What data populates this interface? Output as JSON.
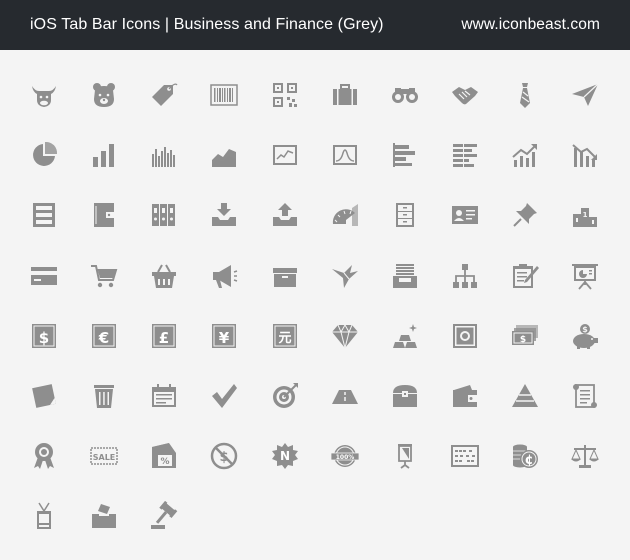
{
  "header": {
    "title": "iOS Tab Bar Icons | Business and Finance (Grey)",
    "site": "www.iconbeast.com"
  },
  "colors": {
    "header_bg": "#262a2f",
    "header_text": "#ffffff",
    "page_bg": "#f4f4f4",
    "icon_fill": "#8e8e8e"
  },
  "rows": [
    [
      "bull-icon",
      "bear-icon",
      "price-tag-icon",
      "barcode-icon",
      "qr-code-icon",
      "briefcase-icon",
      "binoculars-icon",
      "handshake-icon",
      "necktie-icon",
      "paper-plane-icon"
    ],
    [
      "pie-chart-icon",
      "bar-chart-icon",
      "bar-graph-thin-icon",
      "area-chart-icon",
      "line-chart-screen-icon",
      "bell-curve-screen-icon",
      "horizontal-bar-chart-icon",
      "stacked-bar-chart-icon",
      "trend-up-icon",
      "trend-down-icon"
    ],
    [
      "server-cabinet-icon",
      "wallet-notebook-icon",
      "binders-icon",
      "inbox-download-icon",
      "outbox-upload-icon",
      "protractor-icon",
      "filing-cabinet-icon",
      "id-card-icon",
      "push-pin-icon",
      "podium-icon"
    ],
    [
      "credit-card-icon",
      "shopping-cart-icon",
      "shopping-basket-icon",
      "megaphone-icon",
      "archive-box-icon",
      "origami-bird-icon",
      "paper-tray-icon",
      "org-chart-icon",
      "clipboard-pencil-icon",
      "presentation-board-icon"
    ],
    [
      "dollar-box-icon",
      "euro-box-icon",
      "pound-box-icon",
      "yen-box-icon",
      "yuan-box-icon",
      "diamond-icon",
      "gold-bars-icon",
      "safe-icon",
      "money-stack-icon",
      "piggy-bank-icon"
    ],
    [
      "sticky-note-icon",
      "trash-bin-icon",
      "calendar-ticket-icon",
      "checkmark-icon",
      "target-dart-icon",
      "road-icon",
      "treasure-chest-icon",
      "wallet-icon",
      "pyramid-icon",
      "scroll-document-icon"
    ],
    [
      "award-ribbon-icon",
      "sale-tag-icon",
      "discount-flag-icon",
      "no-money-icon",
      "n-badge-icon",
      "hundred-percent-badge-icon",
      "banner-stand-icon",
      "abacus-icon",
      "coins-icon",
      "balance-scale-icon"
    ],
    [
      "id-badge-icon",
      "ballot-box-icon",
      "gavel-icon"
    ]
  ],
  "icon_text": {
    "dollar": "$",
    "euro": "€",
    "pound": "£",
    "yen": "¥",
    "yuan": "元",
    "sale": "SALE",
    "percent": "%",
    "n": "N",
    "hundred": "100%",
    "podium": "1"
  }
}
